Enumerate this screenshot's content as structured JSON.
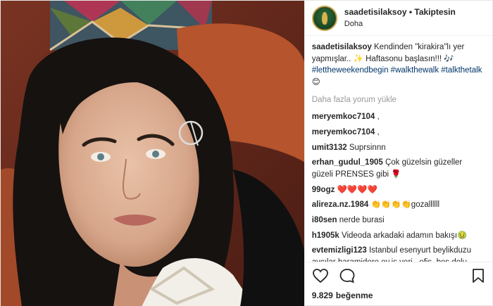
{
  "post": {
    "username": "saadetisilaksoy",
    "separator": "•",
    "follow_status": "Takiptesin",
    "location": "Doha"
  },
  "caption": {
    "username": "saadetisilaksoy",
    "text": "Kendinden \"kirakira\"lı yer yapmışlar.. ✨ Haftasonu başlasın!!! 🎶",
    "tags": [
      "#lettheweekendbegin",
      "#walkthewalk",
      "#talkthetalk"
    ],
    "emoji_end": "😊"
  },
  "load_more": "Daha fazla yorum yükle",
  "comments": [
    {
      "user": "meryemkoc7104",
      "text": ","
    },
    {
      "user": "meryemkoc7104",
      "text": ","
    },
    {
      "user": "umit3132",
      "text": "Suprsinnn"
    },
    {
      "user": "erhan_gudul_1905",
      "text": "Çok güzelsin güzeller güzeli PRENSES gibi 🌹"
    },
    {
      "user": "99ogz",
      "text": "❤️❤️❤️❤️"
    },
    {
      "user": "alireza.nz.1984",
      "text": "👏👏👏👏gozallllll"
    },
    {
      "user": "i80sen",
      "text": "nerde burasi"
    },
    {
      "user": "h1905k",
      "text": "Videoda arkadaki adamın bakışı🤢"
    },
    {
      "user": "evtemizligi123",
      "text": "Istanbul esenyurt beylikduzu avcılar haramidere ev.iş yeri , ofis, boş dolu daire temizligine eleman"
    }
  ],
  "actions": {
    "like_icon": "heart-icon",
    "comment_icon": "comment-icon",
    "save_icon": "bookmark-icon"
  },
  "likes": {
    "count": "9.829",
    "label": "beğenme"
  },
  "colors": {
    "hashtag": "#003569",
    "muted": "#999999",
    "text": "#262626"
  }
}
